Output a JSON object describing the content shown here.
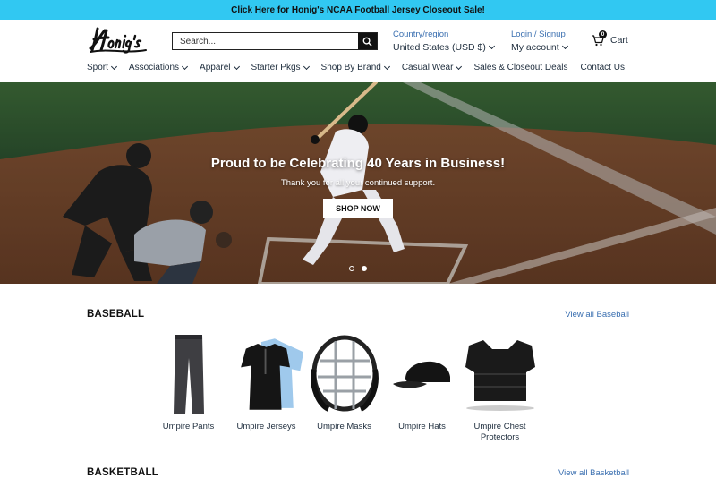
{
  "announcement": "Click Here for Honig's NCAA Football Jersey Closeout Sale!",
  "logo_text": "Honig's",
  "search": {
    "placeholder": "Search..."
  },
  "region": {
    "label": "Country/region",
    "value": "United States (USD $)"
  },
  "account": {
    "login": "Login / Signup",
    "label": "My account"
  },
  "cart": {
    "label": "Cart",
    "count": "0"
  },
  "nav": [
    {
      "label": "Sport",
      "dropdown": true
    },
    {
      "label": "Associations",
      "dropdown": true
    },
    {
      "label": "Apparel",
      "dropdown": true
    },
    {
      "label": "Starter Pkgs",
      "dropdown": true
    },
    {
      "label": "Shop By Brand",
      "dropdown": true
    },
    {
      "label": "Casual Wear",
      "dropdown": true
    },
    {
      "label": "Sales & Closeout Deals",
      "dropdown": false
    },
    {
      "label": "Contact Us",
      "dropdown": false
    }
  ],
  "hero": {
    "title": "Proud to be Celebrating 40 Years in Business!",
    "subtitle": "Thank you for all your continued support.",
    "button": "SHOP NOW",
    "slides": 2,
    "active_slide": 2
  },
  "baseball": {
    "title": "BASEBALL",
    "view_all": "View all Baseball",
    "products": [
      {
        "name": "Umpire Pants",
        "icon": "pants-icon"
      },
      {
        "name": "Umpire Jerseys",
        "icon": "jersey-icon"
      },
      {
        "name": "Umpire Masks",
        "icon": "mask-icon"
      },
      {
        "name": "Umpire Hats",
        "icon": "hat-icon"
      },
      {
        "name": "Umpire Chest Protectors",
        "icon": "chest-protector-icon"
      }
    ]
  },
  "basketball": {
    "title": "BASKETBALL",
    "view_all": "View all Basketball"
  },
  "colors": {
    "announcement_bg": "#31c8f2",
    "link": "#3a6fb0",
    "text": "#1e2d3d"
  }
}
